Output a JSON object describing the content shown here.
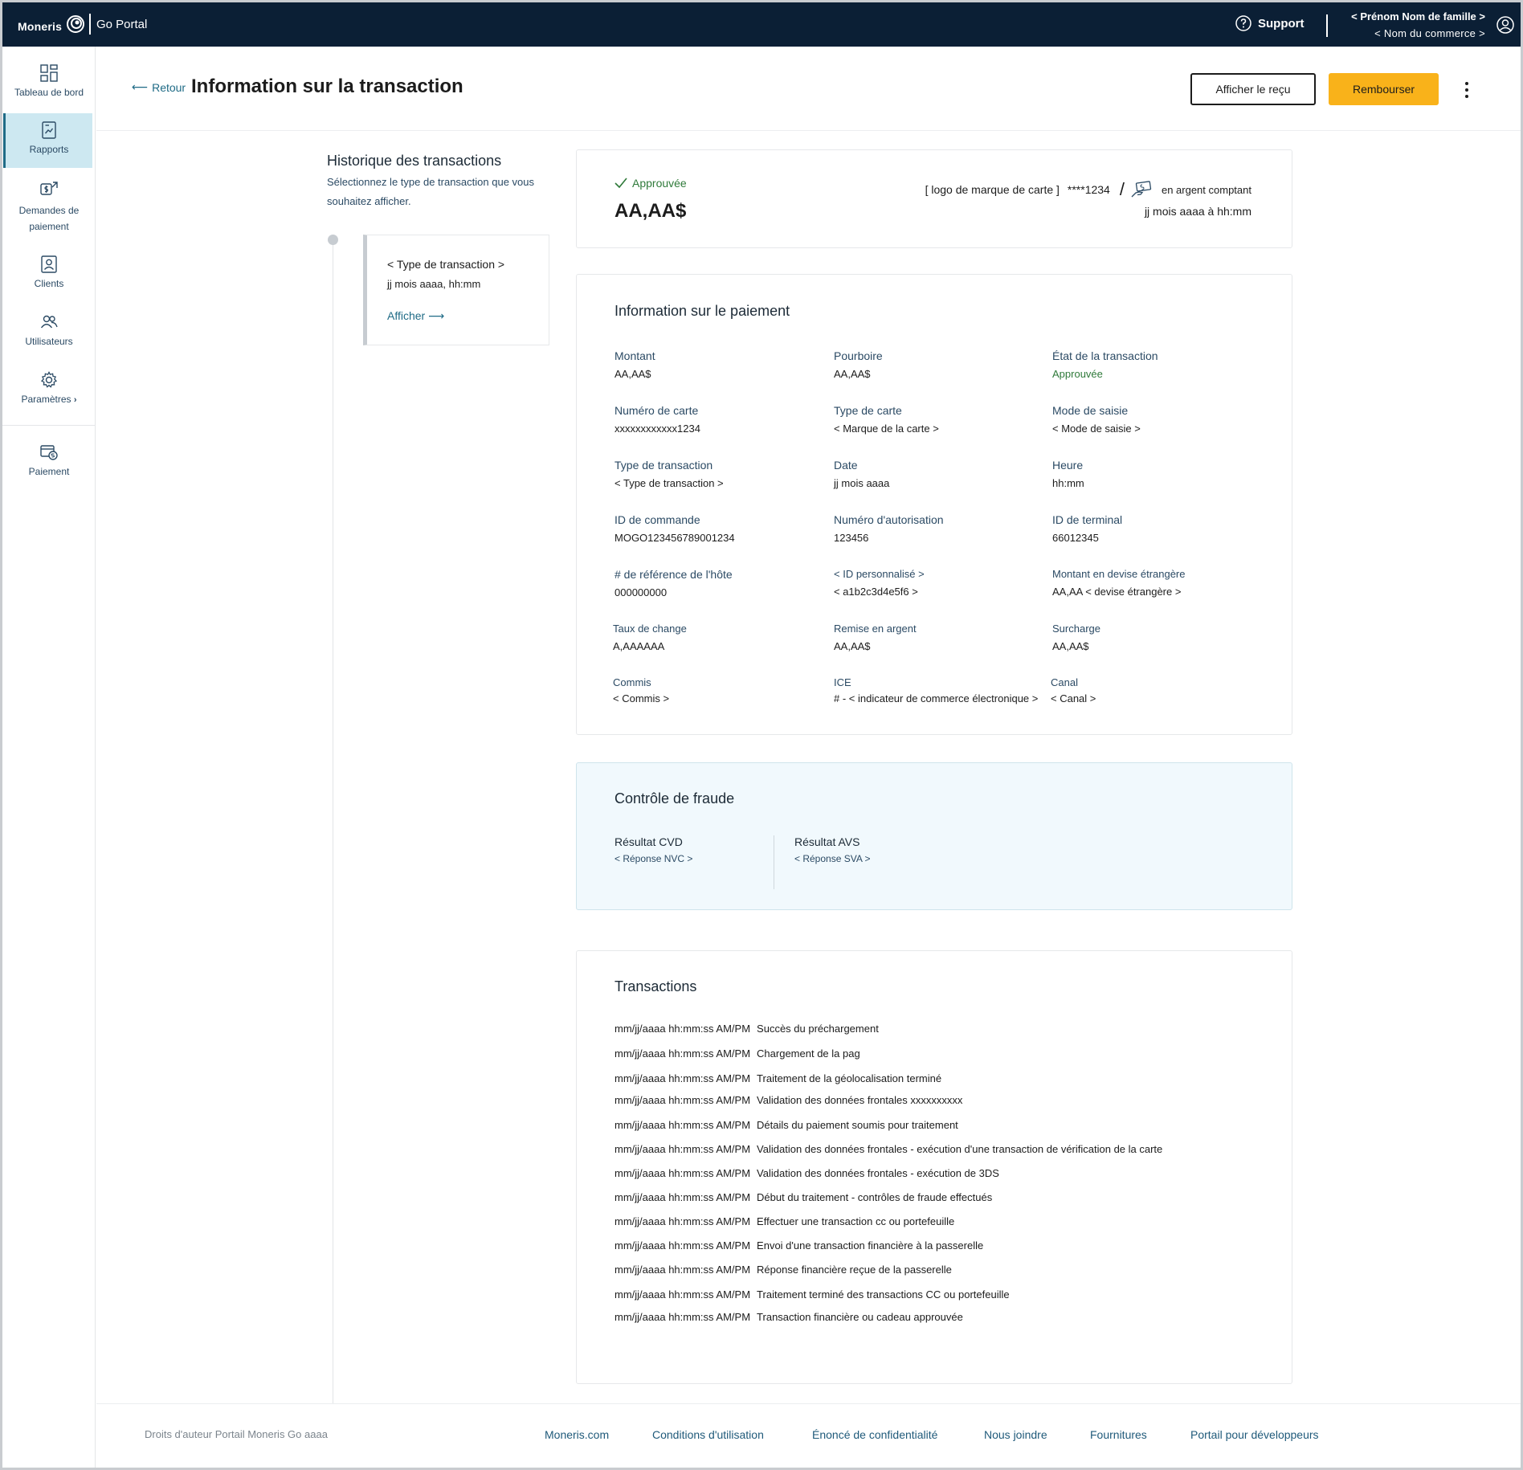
{
  "topbar": {
    "brand": "Moneris",
    "portal": "Go Portal",
    "support": "Support",
    "user_name": "< Prénom Nom de famille >",
    "merchant_name": "< Nom du commerce >"
  },
  "sidebar": {
    "items": [
      {
        "label": "Tableau de bord",
        "icon": "dashboard-icon"
      },
      {
        "label": "Rapports",
        "icon": "report-icon"
      },
      {
        "label": "Demandes de paiement",
        "icon": "payment-request-icon"
      },
      {
        "label": "Clients",
        "icon": "clients-icon"
      },
      {
        "label": "Utilisateurs",
        "icon": "users-icon"
      },
      {
        "label": "Paramètres",
        "icon": "gear-icon"
      },
      {
        "label": "Paiement",
        "icon": "payment-icon"
      }
    ]
  },
  "header": {
    "back": "Retour",
    "title": "Information sur la transaction",
    "receipt_button": "Afficher le reçu",
    "refund_button": "Rembourser"
  },
  "history": {
    "title": "Historique des transactions",
    "subtitle": "Sélectionnez le type de transaction que vous souhaitez afficher.",
    "card": {
      "type": "< Type de transaction >",
      "date": "jj mois aaaa, hh:mm",
      "link": "Afficher"
    }
  },
  "summary": {
    "status": "Approuvée",
    "amount": "AA,AA$",
    "card_logo": "[ logo de marque de carte ]",
    "card_number": "****1234",
    "slash": "/",
    "cash": "en argent comptant",
    "datetime": "jj mois aaaa à hh:mm"
  },
  "payment": {
    "title": "Information sur le paiement",
    "fields": [
      {
        "label": "Montant",
        "value": "AA,AA$"
      },
      {
        "label": "Pourboire",
        "value": "AA,AA$"
      },
      {
        "label": "État de la transaction",
        "value": "Approuvée"
      },
      {
        "label": "Numéro de carte",
        "value": "xxxxxxxxxxxx1234"
      },
      {
        "label": "Type de carte",
        "value": "< Marque de la carte >"
      },
      {
        "label": "Mode de saisie",
        "value": "< Mode de saisie >"
      },
      {
        "label": "Type de transaction",
        "value": "< Type de transaction >"
      },
      {
        "label": "Date",
        "value": "jj mois aaaa"
      },
      {
        "label": "Heure",
        "value": "hh:mm"
      },
      {
        "label": "ID de commande",
        "value": "MOGO123456789001234"
      },
      {
        "label": "Numéro d'autorisation",
        "value": "123456"
      },
      {
        "label": "ID de terminal",
        "value": "66012345"
      },
      {
        "label": "# de référence de l'hôte",
        "value": "000000000"
      },
      {
        "label": "< ID personnalisé >",
        "value": "< a1b2c3d4e5f6 >"
      },
      {
        "label": "Montant en devise étrangère",
        "value": "AA,AA < devise étrangère >"
      },
      {
        "label": "Taux de change",
        "value": "A,AAAAAA"
      },
      {
        "label": "Remise en argent",
        "value": "AA,AA$"
      },
      {
        "label": "Surcharge",
        "value": "AA,AA$"
      },
      {
        "label": "Commis",
        "value": "< Commis >"
      },
      {
        "label": "ICE",
        "value": "# - < indicateur de commerce électronique >"
      },
      {
        "label": "Canal",
        "value": "< Canal >"
      }
    ]
  },
  "fraud": {
    "title": "Contrôle de fraude",
    "cvd_label": "Résultat CVD",
    "cvd_value": "< Réponse NVC >",
    "avs_label": "Résultat AVS",
    "avs_value": "< Réponse SVA >"
  },
  "transactions": {
    "title": "Transactions",
    "rows": [
      {
        "ts": "mm/jj/aaaa hh:mm:ss AM/PM",
        "text": "Succès du préchargement"
      },
      {
        "ts": "mm/jj/aaaa hh:mm:ss AM/PM",
        "text": "Chargement de la pag"
      },
      {
        "ts": "mm/jj/aaaa hh:mm:ss AM/PM",
        "text": "Traitement de la géolocalisation terminé"
      },
      {
        "ts": "mm/jj/aaaa hh:mm:ss AM/PM",
        "text": "Validation des données frontales xxxxxxxxxx"
      },
      {
        "ts": "mm/jj/aaaa hh:mm:ss AM/PM",
        "text": "Détails du paiement soumis pour traitement"
      },
      {
        "ts": "mm/jj/aaaa hh:mm:ss AM/PM",
        "text": "Validation des données frontales - exécution d'une transaction de vérification de la carte"
      },
      {
        "ts": "mm/jj/aaaa hh:mm:ss AM/PM",
        "text": "Validation des données frontales - exécution de 3DS"
      },
      {
        "ts": "mm/jj/aaaa hh:mm:ss AM/PM",
        "text": "Début du traitement - contrôles de fraude effectués"
      },
      {
        "ts": "mm/jj/aaaa hh:mm:ss AM/PM",
        "text": "Effectuer une transaction cc ou portefeuille"
      },
      {
        "ts": "mm/jj/aaaa hh:mm:ss AM/PM",
        "text": "Envoi d'une transaction financière à la passerelle"
      },
      {
        "ts": "mm/jj/aaaa hh:mm:ss AM/PM",
        "text": "Réponse financière reçue de la passerelle"
      },
      {
        "ts": "mm/jj/aaaa hh:mm:ss AM/PM",
        "text": "Traitement terminé des transactions CC ou portefeuille"
      },
      {
        "ts": "mm/jj/aaaa hh:mm:ss AM/PM",
        "text": "Transaction financière ou cadeau approuvée"
      }
    ]
  },
  "footer": {
    "copyright": "Droits d'auteur Portail Moneris Go  aaaa",
    "links": [
      "Moneris.com",
      "Conditions d'utilisation",
      "Énoncé de confidentialité",
      "Nous joindre",
      "Fournitures",
      "Portail pour développeurs"
    ]
  },
  "colors": {
    "topbar": "#0b1f35",
    "accent": "#f9b21a",
    "link": "#1f6b86",
    "success": "#2f7a3a",
    "nav_active": "#cde8f1",
    "fraud_bg": "#f1f9fd"
  }
}
